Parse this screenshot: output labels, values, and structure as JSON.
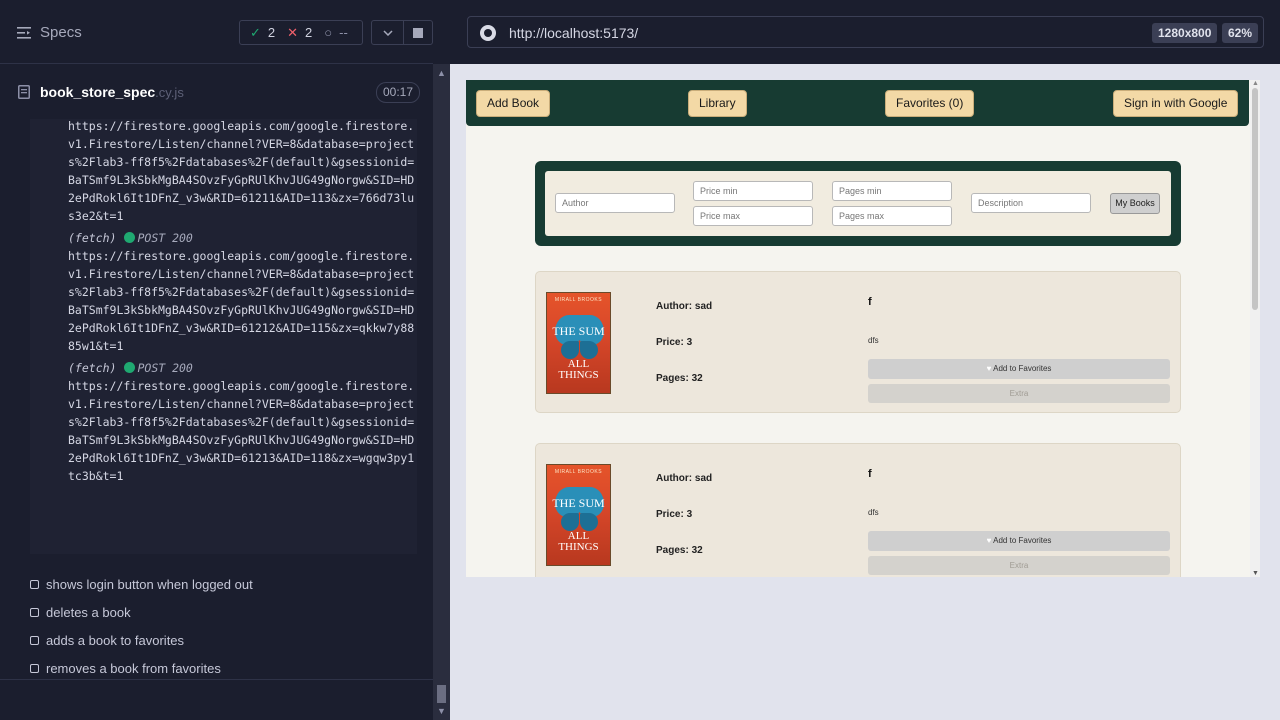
{
  "runner": {
    "specs_label": "Specs",
    "passed": "2",
    "failed": "2",
    "pending": "--",
    "spec_name": "book_store_spec",
    "spec_ext": ".cy.js",
    "duration": "00:17"
  },
  "log": {
    "entries": [
      {
        "head": "",
        "url": "https://firestore.googleapis.com/google.firestore.v1.Firestore/Listen/channel?VER=8&database=projects%2Flab3-ff8f5%2Fdatabases%2F(default)&gsessionid=BaTSmf9L3kSbkMgBA4SOvzFyGpRUlKhvJUG49gNorgw&SID=HD2ePdRokl6It1DFnZ_v3w&RID=61211&AID=113&zx=766d73lus3e2&t=1"
      },
      {
        "head": "(fetch)",
        "method": "POST 200",
        "url": "https://firestore.googleapis.com/google.firestore.v1.Firestore/Listen/channel?VER=8&database=projects%2Flab3-ff8f5%2Fdatabases%2F(default)&gsessionid=BaTSmf9L3kSbkMgBA4SOvzFyGpRUlKhvJUG49gNorgw&SID=HD2ePdRokl6It1DFnZ_v3w&RID=61212&AID=115&zx=qkkw7y8885w1&t=1"
      },
      {
        "head": "(fetch)",
        "method": "POST 200",
        "url": "https://firestore.googleapis.com/google.firestore.v1.Firestore/Listen/channel?VER=8&database=projects%2Flab3-ff8f5%2Fdatabases%2F(default)&gsessionid=BaTSmf9L3kSbkMgBA4SOvzFyGpRUlKhvJUG49gNorgw&SID=HD2ePdRokl6It1DFnZ_v3w&RID=61213&AID=118&zx=wgqw3py1tc3b&t=1"
      }
    ]
  },
  "tests": [
    "shows login button when logged out",
    "deletes a book",
    "adds a book to favorites",
    "removes a book from favorites"
  ],
  "browser": {
    "url": "http://localhost:5173/",
    "viewport": "1280x800",
    "zoom": "62%"
  },
  "app": {
    "nav": {
      "add_book": "Add Book",
      "library": "Library",
      "favorites": "Favorites (0)",
      "sign_in": "Sign in with Google"
    },
    "filters": {
      "author_ph": "Author",
      "price_min_ph": "Price min",
      "price_max_ph": "Price max",
      "pages_min_ph": "Pages min",
      "pages_max_ph": "Pages max",
      "description_ph": "Description",
      "my_books": "My Books"
    },
    "books": [
      {
        "author": "Author: sad",
        "price": "Price: 3",
        "pages": "Pages: 32",
        "title": "f",
        "description": "dfs",
        "fav_label": "Add to Favorites",
        "extra_label": "Extra",
        "cover_author": "MIRALL BROOKS",
        "cover_title_top": "THE SUM",
        "cover_title_bottom": "ALL THINGS"
      },
      {
        "author": "Author: sad",
        "price": "Price: 3",
        "pages": "Pages: 32",
        "title": "f",
        "description": "dfs",
        "fav_label": "Add to Favorites",
        "extra_label": "Extra",
        "cover_author": "MIRALL BROOKS",
        "cover_title_top": "THE SUM",
        "cover_title_bottom": "ALL THINGS"
      }
    ]
  }
}
